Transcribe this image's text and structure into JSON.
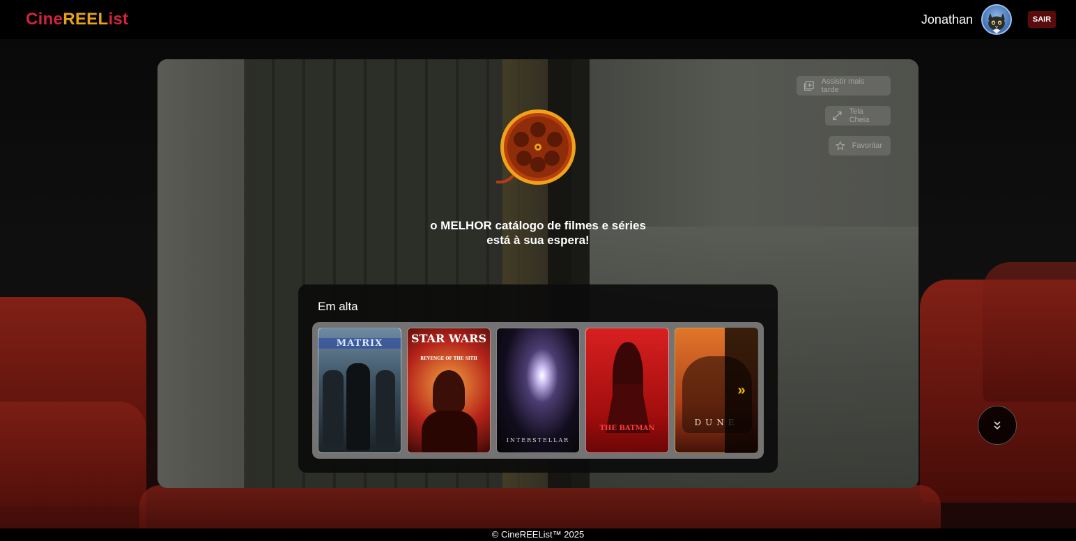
{
  "brand": {
    "part1": "Cine",
    "part2": "REEL",
    "part3": "ist"
  },
  "user": {
    "name": "Jonathan",
    "logout_label": "SAIR"
  },
  "hero": {
    "actions": [
      {
        "label": "Assistir mais tarde",
        "icon": "add-library-icon"
      },
      {
        "label": "Tela Cheia",
        "icon": "expand-icon"
      },
      {
        "label": "Favoritar",
        "icon": "star-icon"
      }
    ],
    "tagline_line1": "o MELHOR catálogo de filmes e séries",
    "tagline_line2": "está à sua espera!"
  },
  "trending": {
    "title": "Em alta",
    "posters": [
      {
        "title": "MATRIX"
      },
      {
        "title": "STAR WARS",
        "subtitle": "REVENGE OF THE SITH"
      },
      {
        "title": "INTERSTELLAR"
      },
      {
        "title": "THE BATMAN"
      },
      {
        "title": "DUNE"
      }
    ],
    "next_label": "»"
  },
  "footer": {
    "text": "© CineREEList™ 2025"
  },
  "colors": {
    "brand_red": "#d4233b",
    "brand_gold": "#e8a219",
    "logout_bg": "#5a0b0b",
    "next_arrow": "#f0c000"
  }
}
